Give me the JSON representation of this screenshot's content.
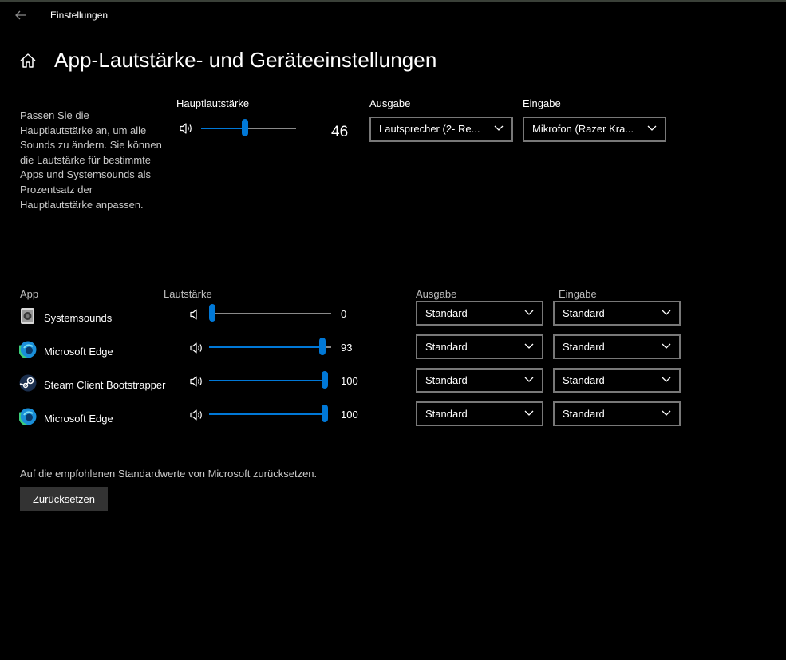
{
  "window": {
    "title": "Einstellungen"
  },
  "page": {
    "title": "App-Lautstärke- und Geräteeinstellungen"
  },
  "description": "Passen Sie die Hauptlautstärke an, um alle Sounds zu ändern. Sie können die Lautstärke für bestimmte Apps und Systemsounds als Prozentsatz der Hauptlautstärke anpassen.",
  "master": {
    "label": "Hauptlautstärke",
    "value": "46",
    "level": 0.46,
    "output_label": "Ausgabe",
    "output_value": "Lautsprecher (2- Re...",
    "input_label": "Eingabe",
    "input_value": "Mikrofon (Razer Kra..."
  },
  "table": {
    "col_app": "App",
    "col_volume": "Lautstärke",
    "col_output": "Ausgabe",
    "col_input": "Eingabe",
    "rows": [
      {
        "name": "Systemsounds",
        "icon": "system-sounds-icon",
        "value": "0",
        "level": 0.0,
        "output": "Standard",
        "input": "Standard"
      },
      {
        "name": "Microsoft Edge",
        "icon": "edge-icon",
        "value": "93",
        "level": 0.93,
        "output": "Standard",
        "input": "Standard"
      },
      {
        "name": "Steam Client Bootstrapper",
        "icon": "steam-icon",
        "value": "100",
        "level": 1.0,
        "output": "Standard",
        "input": "Standard"
      },
      {
        "name": "Microsoft Edge",
        "icon": "edge-icon",
        "value": "100",
        "level": 1.0,
        "output": "Standard",
        "input": "Standard"
      }
    ]
  },
  "reset": {
    "text": "Auf die empfohlenen Standardwerte von Microsoft zurücksetzen.",
    "button": "Zurücksetzen"
  },
  "colors": {
    "accent": "#0078d7",
    "background": "#000000",
    "dropdown_border": "#787878"
  }
}
